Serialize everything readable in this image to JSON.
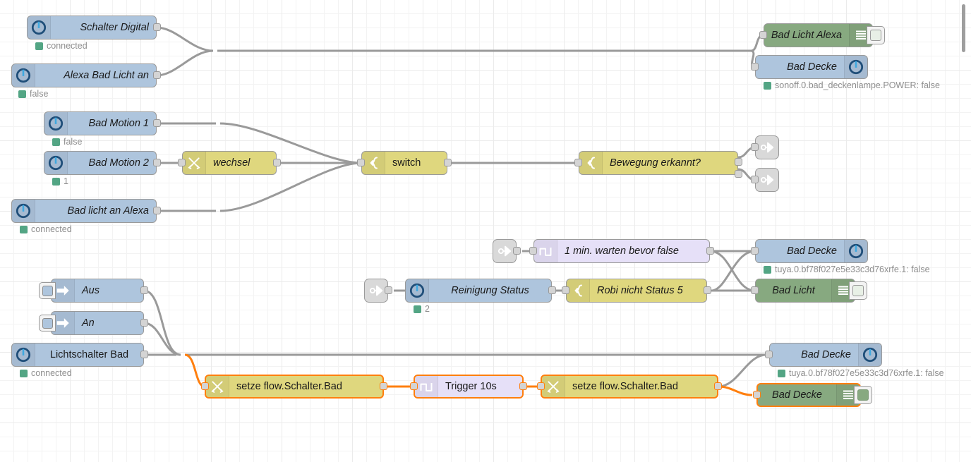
{
  "app": {
    "name": "Node-RED",
    "view": "flow-editor-canvas"
  },
  "colors": {
    "node_blue": "#aec5dd",
    "node_green": "#87a980",
    "node_yellow": "#dfd77e",
    "node_purple": "#e6e0f8",
    "node_grey": "#d9d9d9",
    "wire": "#9a9a9a",
    "wire_selected": "#ff7f0e",
    "selection_border": "#ff7f0e",
    "status_dot_green": "#53a584",
    "canvas_background": "#ffffff",
    "grid_minor": "#f3f3f3",
    "grid_major": "#ebebeb"
  },
  "nodes": {
    "schalter_digital": {
      "label": "Schalter Digital",
      "status": "connected",
      "icon": "power-circle-icon"
    },
    "alexa_bad_licht_an": {
      "label": "Alexa Bad Licht an",
      "status": "false",
      "icon": "power-circle-icon"
    },
    "bad_licht_alexa": {
      "label": "Bad Licht Alexa",
      "status": "",
      "icon": "debug-lines-icon"
    },
    "bad_decke_top": {
      "label": "Bad Decke",
      "status": "sonoff.0.bad_deckenlampe.POWER: false",
      "icon": "power-circle-icon"
    },
    "bad_motion_1": {
      "label": "Bad Motion 1",
      "status": "false",
      "icon": "power-circle-icon"
    },
    "bad_motion_2": {
      "label": "Bad Motion 2",
      "status": "1",
      "icon": "power-circle-icon"
    },
    "wechsel": {
      "label": "wechsel",
      "status": "",
      "icon": "change-icon"
    },
    "switch": {
      "label": "switch",
      "status": "",
      "icon": "switch-icon"
    },
    "bewegung_erkannt": {
      "label": "Bewegung erkannt?",
      "status": "",
      "icon": "switch-icon"
    },
    "link_out_1": {
      "label": "",
      "status": "",
      "icon": "link-out-icon"
    },
    "link_out_2": {
      "label": "",
      "status": "",
      "icon": "link-out-icon"
    },
    "bad_licht_an_alexa": {
      "label": "Bad licht an Alexa",
      "status": "connected",
      "icon": "power-circle-icon"
    },
    "link_in_1": {
      "label": "",
      "status": "",
      "icon": "link-in-icon"
    },
    "warten_1min": {
      "label": "1 min. warten bevor false",
      "status": "",
      "icon": "trigger-icon"
    },
    "bad_decke_mid": {
      "label": "Bad Decke",
      "status": "tuya.0.bf78f027e5e33c3d76xrfe.1: false",
      "icon": "power-circle-icon"
    },
    "link_in_2": {
      "label": "",
      "status": "",
      "icon": "link-in-icon"
    },
    "reinigung_status": {
      "label": "Reinigung Status",
      "status": "2",
      "icon": "power-circle-icon"
    },
    "robi_nicht_status_5": {
      "label": "Robi nicht Status 5",
      "status": "",
      "icon": "switch-icon"
    },
    "bad_licht": {
      "label": "Bad Licht",
      "status": "",
      "icon": "debug-lines-icon"
    },
    "aus": {
      "label": "Aus",
      "status": "",
      "icon": "inject-arrow-icon"
    },
    "an": {
      "label": "An",
      "status": "",
      "icon": "inject-arrow-icon"
    },
    "lichtschalter_bad": {
      "label": "Lichtschalter Bad",
      "status": "connected",
      "icon": "power-circle-icon"
    },
    "setze_flow_1": {
      "label": "setze flow.Schalter.Bad",
      "status": "",
      "icon": "change-icon"
    },
    "trigger_10s": {
      "label": "Trigger 10s",
      "status": "",
      "icon": "trigger-icon"
    },
    "setze_flow_2": {
      "label": "setze flow.Schalter.Bad",
      "status": "",
      "icon": "change-icon"
    },
    "bad_decke_bottom": {
      "label": "Bad Decke",
      "status": "tuya.0.bf78f027e5e33c3d76xrfe.1: false",
      "icon": "power-circle-icon"
    },
    "bad_decke_debug": {
      "label": "Bad Decke",
      "status": "",
      "icon": "debug-lines-icon"
    }
  }
}
